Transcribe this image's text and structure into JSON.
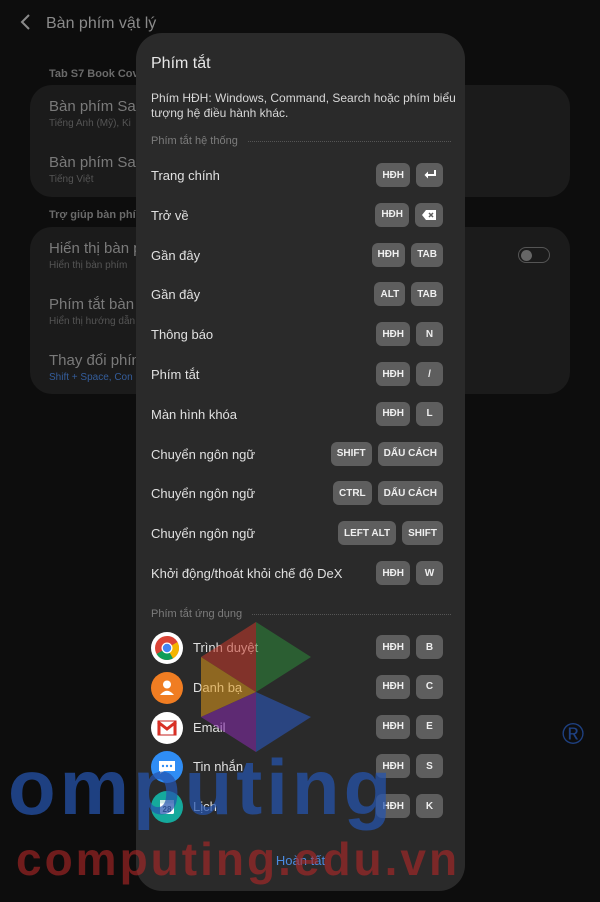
{
  "background": {
    "title": "Bàn phím vật lý",
    "section1": "Tab S7 Book Cov",
    "item1_title": "Bàn phím San",
    "item1_sub": "Tiếng Anh (Mỹ), Ki",
    "item2_title": "Bàn phím San",
    "item2_sub": "Tiếng Việt",
    "section2": "Trợ giúp bàn phím",
    "item3_title": "Hiển thị bàn p",
    "item3_sub": "Hiển thị bàn phím",
    "item4_title": "Phím tắt bàn p",
    "item4_sub": "Hiển thị hướng dẫn",
    "item5_title": "Thay đổi phím",
    "item5_sub": "Shift + Space, Con"
  },
  "dialog": {
    "title": "Phím tắt",
    "description": "Phím HĐH: Windows, Command, Search hoặc phím biểu tượng hệ điều hành khác.",
    "system_section": "Phím tắt hệ thống",
    "system_rows": [
      {
        "label": "Trang chính",
        "keys": [
          "HĐH"
        ],
        "icon": "enter-icon"
      },
      {
        "label": "Trở về",
        "keys": [
          "HĐH"
        ],
        "icon": "backspace-icon"
      },
      {
        "label": "Gần đây",
        "keys": [
          "HĐH",
          "TAB"
        ]
      },
      {
        "label": "Gần đây",
        "keys": [
          "ALT",
          "TAB"
        ]
      },
      {
        "label": "Thông báo",
        "keys": [
          "HĐH",
          "N"
        ]
      },
      {
        "label": "Phím tắt",
        "keys": [
          "HĐH",
          "/"
        ]
      },
      {
        "label": "Màn hình khóa",
        "keys": [
          "HĐH",
          "L"
        ]
      },
      {
        "label": "Chuyển ngôn ngữ",
        "keys": [
          "SHIFT",
          "DẤU CÁCH"
        ]
      },
      {
        "label": "Chuyển ngôn ngữ",
        "keys": [
          "CTRL",
          "DẤU CÁCH"
        ]
      },
      {
        "label": "Chuyển ngôn ngữ",
        "keys": [
          "LEFT ALT",
          "SHIFT"
        ]
      },
      {
        "label": "Khởi động/thoát khỏi chế độ DeX",
        "keys": [
          "HĐH",
          "W"
        ]
      }
    ],
    "app_section": "Phím tắt ứng dụng",
    "app_rows": [
      {
        "label": "Trình duyệt",
        "keys": [
          "HĐH",
          "B"
        ],
        "icon": "chrome-icon"
      },
      {
        "label": "Danh bạ",
        "keys": [
          "HĐH",
          "C"
        ],
        "icon": "contacts-icon"
      },
      {
        "label": "Email",
        "keys": [
          "HĐH",
          "E"
        ],
        "icon": "gmail-icon"
      },
      {
        "label": "Tin nhắn",
        "keys": [
          "HĐH",
          "S"
        ],
        "icon": "messages-icon"
      },
      {
        "label": "Lịch",
        "keys": [
          "HĐH",
          "K"
        ],
        "icon": "calendar-icon"
      }
    ],
    "done_label": "Hoàn tất"
  },
  "watermark": {
    "big_text": "omputing",
    "registered": "®",
    "small_text": "computing.edu.vn"
  },
  "colors": {
    "dialog_bg": "#2a2a2a",
    "key_bg": "#5e5e5e",
    "accent": "#4a8be0"
  }
}
